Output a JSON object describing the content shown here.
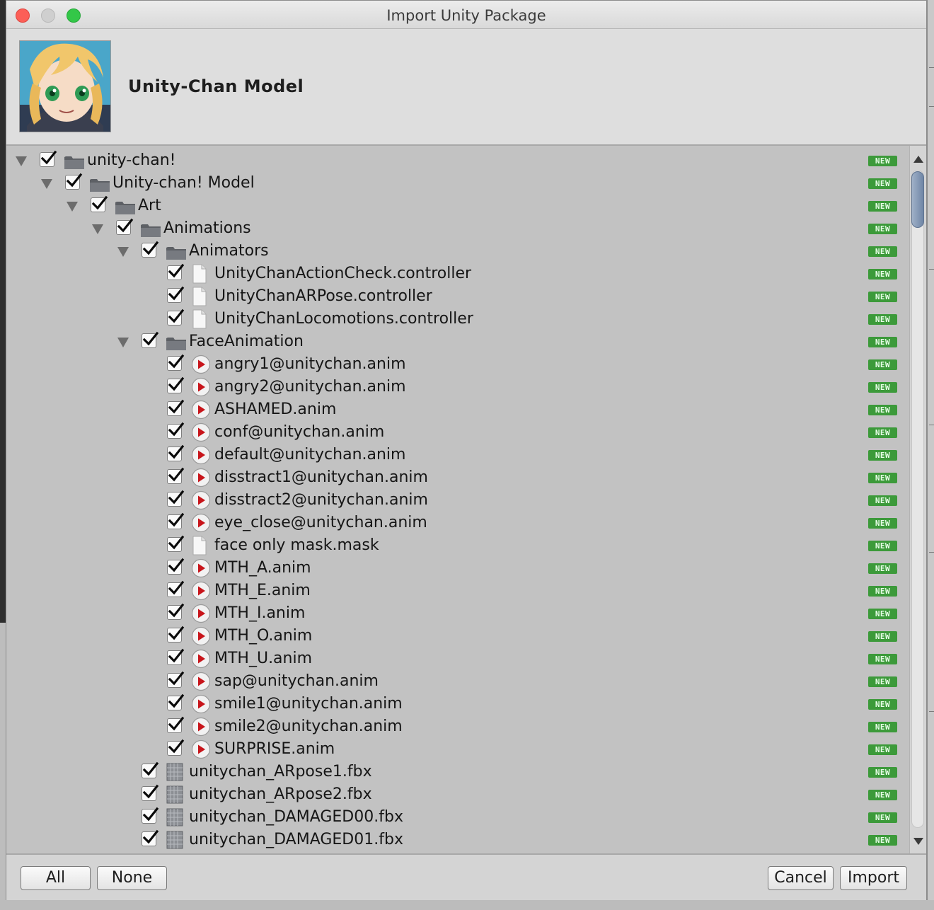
{
  "window": {
    "title": "Import Unity Package"
  },
  "package": {
    "name": "Unity-Chan Model",
    "icon": "unity-chan-portrait"
  },
  "new_badge": "NEW",
  "tree": [
    {
      "label": "unity-chan!",
      "icon": "folder-icon",
      "depth": 0,
      "expanded": true,
      "checked": true
    },
    {
      "label": "Unity-chan! Model",
      "icon": "folder-icon",
      "depth": 1,
      "expanded": true,
      "checked": true
    },
    {
      "label": "Art",
      "icon": "folder-icon",
      "depth": 2,
      "expanded": true,
      "checked": true
    },
    {
      "label": "Animations",
      "icon": "folder-icon",
      "depth": 3,
      "expanded": true,
      "checked": true
    },
    {
      "label": "Animators",
      "icon": "folder-icon",
      "depth": 4,
      "expanded": true,
      "checked": true
    },
    {
      "label": "UnityChanActionCheck.controller",
      "icon": "file-icon",
      "depth": 5,
      "checked": true
    },
    {
      "label": "UnityChanARPose.controller",
      "icon": "file-icon",
      "depth": 5,
      "checked": true
    },
    {
      "label": "UnityChanLocomotions.controller",
      "icon": "file-icon",
      "depth": 5,
      "checked": true
    },
    {
      "label": "FaceAnimation",
      "icon": "folder-icon",
      "depth": 4,
      "expanded": true,
      "checked": true
    },
    {
      "label": "angry1@unitychan.anim",
      "icon": "animation-icon",
      "depth": 5,
      "checked": true
    },
    {
      "label": "angry2@unitychan.anim",
      "icon": "animation-icon",
      "depth": 5,
      "checked": true
    },
    {
      "label": "ASHAMED.anim",
      "icon": "animation-icon",
      "depth": 5,
      "checked": true
    },
    {
      "label": "conf@unitychan.anim",
      "icon": "animation-icon",
      "depth": 5,
      "checked": true
    },
    {
      "label": "default@unitychan.anim",
      "icon": "animation-icon",
      "depth": 5,
      "checked": true
    },
    {
      "label": "disstract1@unitychan.anim",
      "icon": "animation-icon",
      "depth": 5,
      "checked": true
    },
    {
      "label": "disstract2@unitychan.anim",
      "icon": "animation-icon",
      "depth": 5,
      "checked": true
    },
    {
      "label": "eye_close@unitychan.anim",
      "icon": "animation-icon",
      "depth": 5,
      "checked": true
    },
    {
      "label": "face only mask.mask",
      "icon": "file-icon",
      "depth": 5,
      "checked": true
    },
    {
      "label": "MTH_A.anim",
      "icon": "animation-icon",
      "depth": 5,
      "checked": true
    },
    {
      "label": "MTH_E.anim",
      "icon": "animation-icon",
      "depth": 5,
      "checked": true
    },
    {
      "label": "MTH_I.anim",
      "icon": "animation-icon",
      "depth": 5,
      "checked": true
    },
    {
      "label": "MTH_O.anim",
      "icon": "animation-icon",
      "depth": 5,
      "checked": true
    },
    {
      "label": "MTH_U.anim",
      "icon": "animation-icon",
      "depth": 5,
      "checked": true
    },
    {
      "label": "sap@unitychan.anim",
      "icon": "animation-icon",
      "depth": 5,
      "checked": true
    },
    {
      "label": "smile1@unitychan.anim",
      "icon": "animation-icon",
      "depth": 5,
      "checked": true
    },
    {
      "label": "smile2@unitychan.anim",
      "icon": "animation-icon",
      "depth": 5,
      "checked": true
    },
    {
      "label": "SURPRISE.anim",
      "icon": "animation-icon",
      "depth": 5,
      "checked": true
    },
    {
      "label": "unitychan_ARpose1.fbx",
      "icon": "model-icon",
      "depth": 4,
      "checked": true
    },
    {
      "label": "unitychan_ARpose2.fbx",
      "icon": "model-icon",
      "depth": 4,
      "checked": true
    },
    {
      "label": "unitychan_DAMAGED00.fbx",
      "icon": "model-icon",
      "depth": 4,
      "checked": true
    },
    {
      "label": "unitychan_DAMAGED01.fbx",
      "icon": "model-icon",
      "depth": 4,
      "checked": true
    }
  ],
  "buttons": {
    "all": "All",
    "none": "None",
    "cancel": "Cancel",
    "import": "Import"
  },
  "colors": {
    "new_badge": "#3c9a3a",
    "anim_red": "#c8151b",
    "scroll_thumb": "#6f86a6"
  }
}
